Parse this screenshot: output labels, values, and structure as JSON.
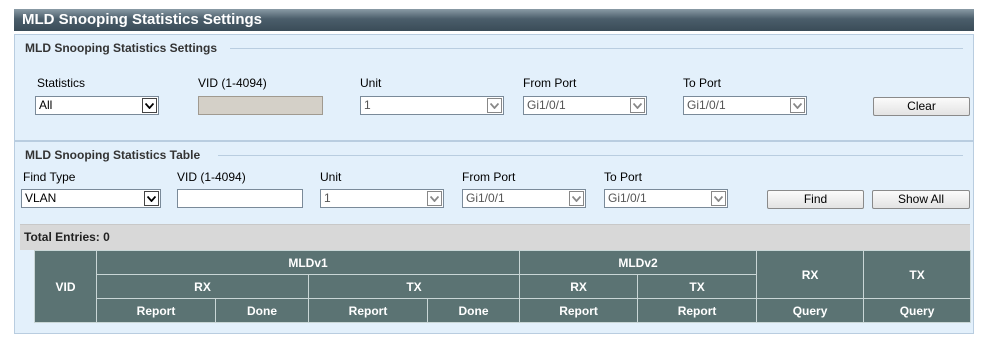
{
  "title": "MLD Snooping Statistics Settings",
  "settings": {
    "legend": "MLD Snooping Statistics Settings",
    "labels": {
      "statistics": "Statistics",
      "vid": "VID (1-4094)",
      "unit": "Unit",
      "from_port": "From Port",
      "to_port": "To Port"
    },
    "statistics_value": "All",
    "vid_value": "",
    "unit_value": "1",
    "from_port_value": "Gi1/0/1",
    "to_port_value": "Gi1/0/1",
    "clear_label": "Clear"
  },
  "table_section": {
    "legend": "MLD Snooping Statistics Table",
    "labels": {
      "find_type": "Find Type",
      "vid": "VID (1-4094)",
      "unit": "Unit",
      "from_port": "From Port",
      "to_port": "To Port"
    },
    "find_type_value": "VLAN",
    "vid_value": "",
    "unit_value": "1",
    "from_port_value": "Gi1/0/1",
    "to_port_value": "Gi1/0/1",
    "find_label": "Find",
    "show_all_label": "Show All",
    "total_entries": "Total Entries: 0"
  },
  "table": {
    "vid": "VID",
    "mldv1": "MLDv1",
    "mldv2": "MLDv2",
    "rx": "RX",
    "tx": "TX",
    "report": "Report",
    "done": "Done",
    "query": "Query"
  },
  "colors": {
    "header_bar": "#4b5e6b",
    "panel_bg": "#e3f0fb",
    "table_header": "#5b7373"
  },
  "icons": {
    "dropdown": "chevron-down-icon"
  }
}
